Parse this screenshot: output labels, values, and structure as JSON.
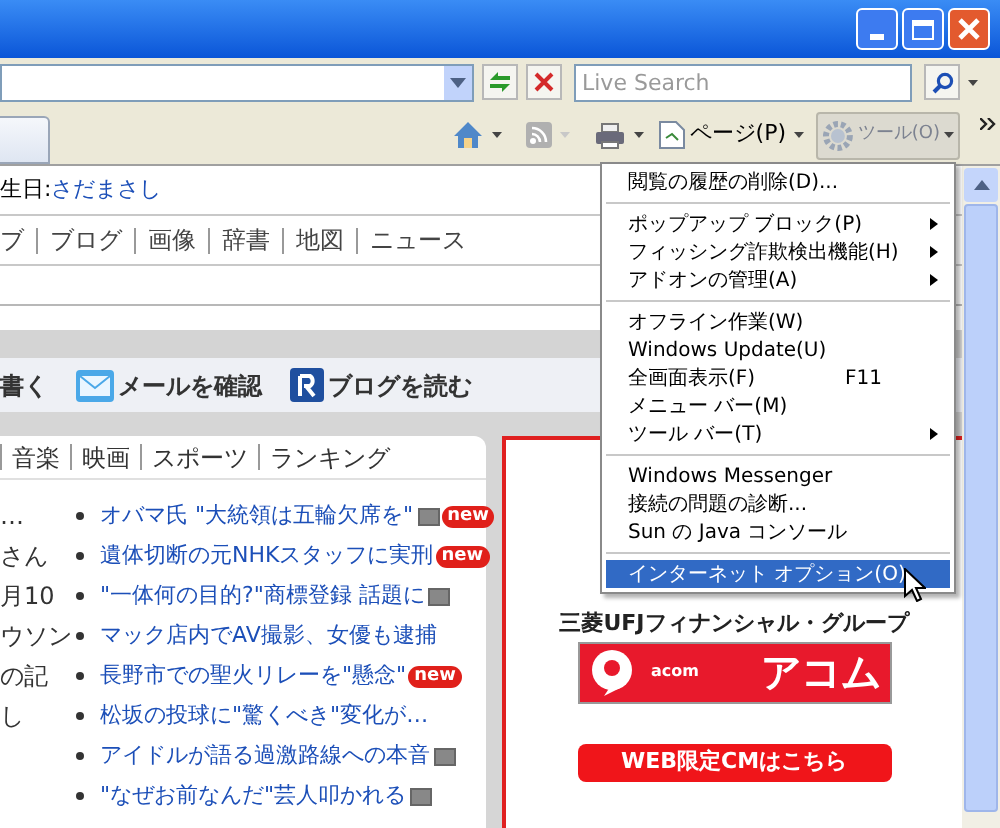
{
  "address_bar": {
    "search_placeholder": "Live Search"
  },
  "command_bar": {
    "page_label": "ページ(P)",
    "tools_label": "ツール(O)",
    "tools_pressed": true
  },
  "page": {
    "birthday_label": "生日:",
    "birthday_name": "さだまさし",
    "nav": [
      "ブ",
      "ブログ",
      "画像",
      "辞書",
      "地図",
      "ニュース"
    ],
    "quick_links": [
      {
        "kind": "text",
        "label": "書く"
      },
      {
        "kind": "mail",
        "label": "メールを確認"
      },
      {
        "kind": "reader",
        "label": "ブログを読む"
      }
    ],
    "category_tabs": [
      "音楽",
      "映画",
      "スポーツ",
      "ランキング"
    ],
    "left_fragments": [
      "…",
      "さん",
      "月10",
      "ウソン",
      "の記",
      "し"
    ],
    "news": [
      {
        "title": "オバマ氏 \"大統領は五輪欠席を\"",
        "photo": true,
        "badge": "new"
      },
      {
        "title": "遺体切断の元NHKスタッフに実刑",
        "photo": false,
        "badge": "new"
      },
      {
        "title": "\"一体何の目的?\"商標登録 話題に",
        "photo": true
      },
      {
        "title": "マック店内でAV撮影、女優も逮捕",
        "photo": false
      },
      {
        "title": "長野市での聖火リレーを\"懸念\"",
        "photo": false,
        "badge": "new"
      },
      {
        "title": "松坂の投球に\"驚くべき\"変化が…",
        "photo": false
      },
      {
        "title": "アイドルが語る過激路線への本音",
        "photo": true
      },
      {
        "title": "\"なぜお前なんだ\"芸人叩かれる",
        "photo": true
      }
    ],
    "ad": {
      "group": "三菱UFJフィナンシャル・グループ",
      "brand_small": "acom",
      "brand": "アコム",
      "button": "WEB限定CMはこちら"
    }
  },
  "menu": {
    "items": [
      {
        "kind": "item",
        "label": "閲覧の履歴の削除(D)...",
        "submenu": false,
        "selected": false
      },
      {
        "kind": "separator"
      },
      {
        "kind": "item",
        "label": "ポップアップ ブロック(P)",
        "submenu": true,
        "selected": false
      },
      {
        "kind": "item",
        "label": "フィッシング詐欺検出機能(H)",
        "submenu": true,
        "selected": false
      },
      {
        "kind": "item",
        "label": "アドオンの管理(A)",
        "submenu": true,
        "selected": false
      },
      {
        "kind": "separator"
      },
      {
        "kind": "item",
        "label": "オフライン作業(W)",
        "submenu": false,
        "selected": false
      },
      {
        "kind": "item",
        "label": "Windows Update(U)",
        "submenu": false,
        "selected": false
      },
      {
        "kind": "item",
        "label": "全画面表示(F)",
        "shortcut": "F11",
        "submenu": false,
        "selected": false
      },
      {
        "kind": "item",
        "label": "メニュー バー(M)",
        "submenu": false,
        "selected": false
      },
      {
        "kind": "item",
        "label": "ツール バー(T)",
        "submenu": true,
        "selected": false
      },
      {
        "kind": "separator"
      },
      {
        "kind": "item",
        "label": "Windows Messenger",
        "submenu": false,
        "selected": false
      },
      {
        "kind": "item",
        "label": "接続の問題の診断...",
        "submenu": false,
        "selected": false
      },
      {
        "kind": "item",
        "label": "Sun の Java コンソール",
        "submenu": false,
        "selected": false
      },
      {
        "kind": "separator"
      },
      {
        "kind": "item",
        "label": "インターネット オプション(O)",
        "submenu": false,
        "selected": true
      }
    ]
  }
}
